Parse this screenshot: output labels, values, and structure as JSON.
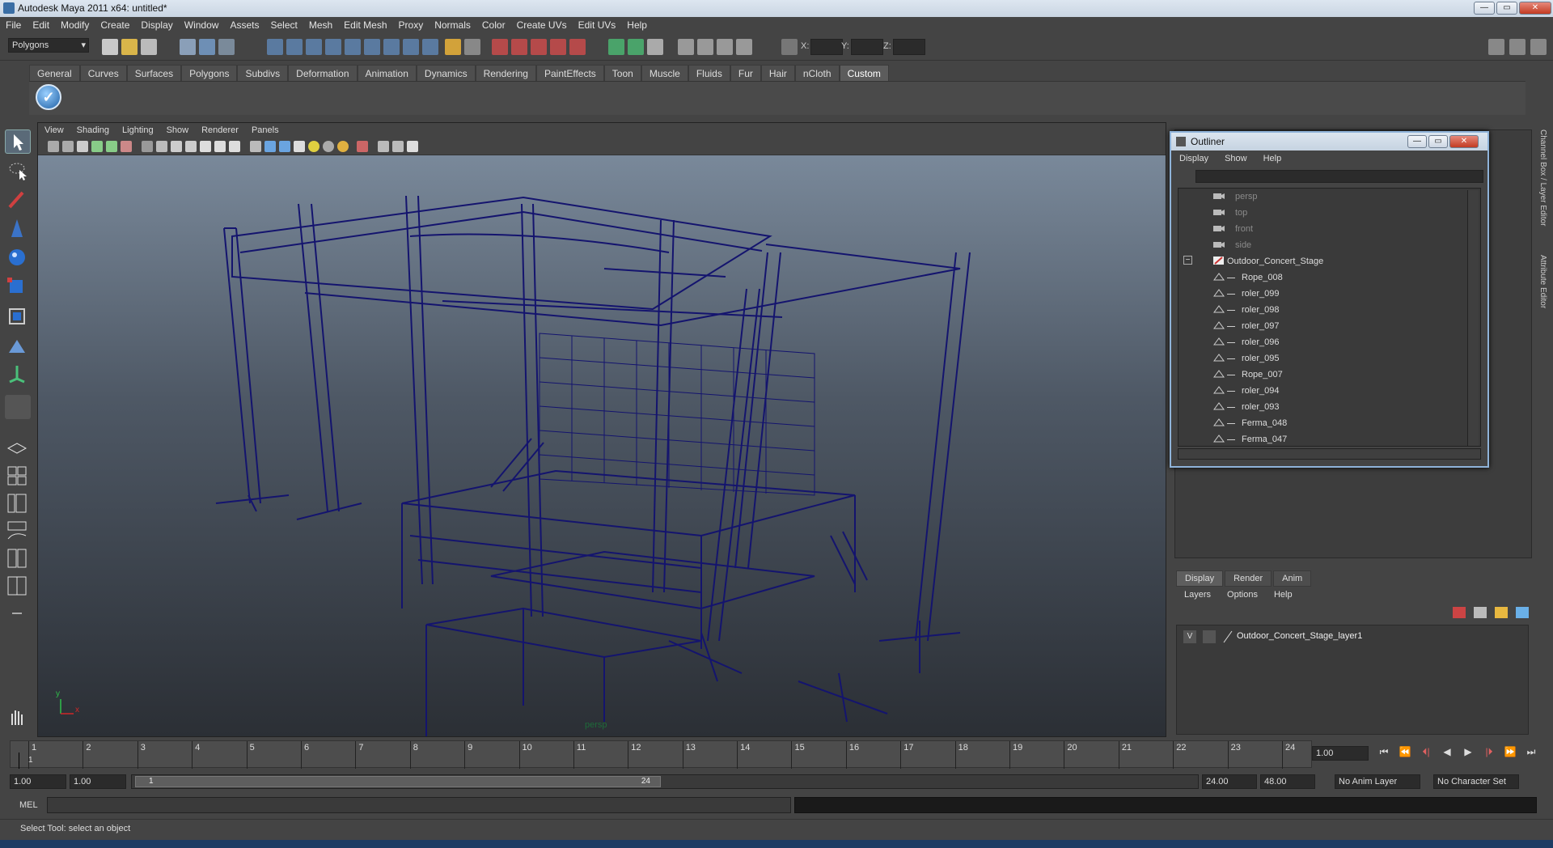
{
  "window": {
    "title": "Autodesk Maya 2011 x64: untitled*",
    "min": "—",
    "max": "▭",
    "close": "✕"
  },
  "menubar": [
    "File",
    "Edit",
    "Modify",
    "Create",
    "Display",
    "Window",
    "Assets",
    "Select",
    "Mesh",
    "Edit Mesh",
    "Proxy",
    "Normals",
    "Color",
    "Create UVs",
    "Edit UVs",
    "Help"
  ],
  "status": {
    "mode": "Polygons",
    "x_label": "X:",
    "y_label": "Y:",
    "z_label": "Z:"
  },
  "shelf": {
    "tabs": [
      "General",
      "Curves",
      "Surfaces",
      "Polygons",
      "Subdivs",
      "Deformation",
      "Animation",
      "Dynamics",
      "Rendering",
      "PaintEffects",
      "Toon",
      "Muscle",
      "Fluids",
      "Fur",
      "Hair",
      "nCloth",
      "Custom"
    ],
    "active": "Custom"
  },
  "viewport": {
    "menu": [
      "View",
      "Shading",
      "Lighting",
      "Show",
      "Renderer",
      "Panels"
    ],
    "camera_label": "persp",
    "axis_y": "y",
    "axis_x": "x",
    "wire_color": "#14146e"
  },
  "outliner": {
    "title": "Outliner",
    "menu": [
      "Display",
      "Show",
      "Help"
    ],
    "cameras": [
      "persp",
      "top",
      "front",
      "side"
    ],
    "root": "Outdoor_Concert_Stage",
    "collapse_symbol": "−",
    "children": [
      "Rope_008",
      "roler_099",
      "roler_098",
      "roler_097",
      "roler_096",
      "roler_095",
      "Rope_007",
      "roler_094",
      "roler_093",
      "Ferma_048",
      "Ferma_047"
    ]
  },
  "layers": {
    "tabs": [
      "Display",
      "Render",
      "Anim"
    ],
    "active_tab": "Display",
    "menu": [
      "Layers",
      "Options",
      "Help"
    ],
    "rows": [
      {
        "visible": "V",
        "name": "Outdoor_Concert_Stage_layer1"
      }
    ]
  },
  "side_tabs": [
    "Channel Box / Layer Editor",
    "Attribute Editor"
  ],
  "timeline": {
    "ticks": [
      "1",
      "2",
      "3",
      "4",
      "5",
      "6",
      "7",
      "8",
      "9",
      "10",
      "11",
      "12",
      "13",
      "14",
      "15",
      "16",
      "17",
      "18",
      "19",
      "20",
      "21",
      "22",
      "23",
      "24"
    ],
    "current_frame_marker": "1",
    "current_time": "1.00",
    "playback": [
      "⏮",
      "⏪",
      "⏴|",
      "◀",
      "▶",
      "|⏵",
      "⏩",
      "⏭"
    ]
  },
  "range": {
    "start": "1.00",
    "playback_start": "1.00",
    "handle_start": "1",
    "handle_end": "24",
    "playback_end": "24.00",
    "end": "48.00",
    "anim_layer": "No Anim Layer",
    "character_set": "No Character Set"
  },
  "command": {
    "label": "MEL"
  },
  "helpline": {
    "text": "Select Tool: select an object"
  }
}
